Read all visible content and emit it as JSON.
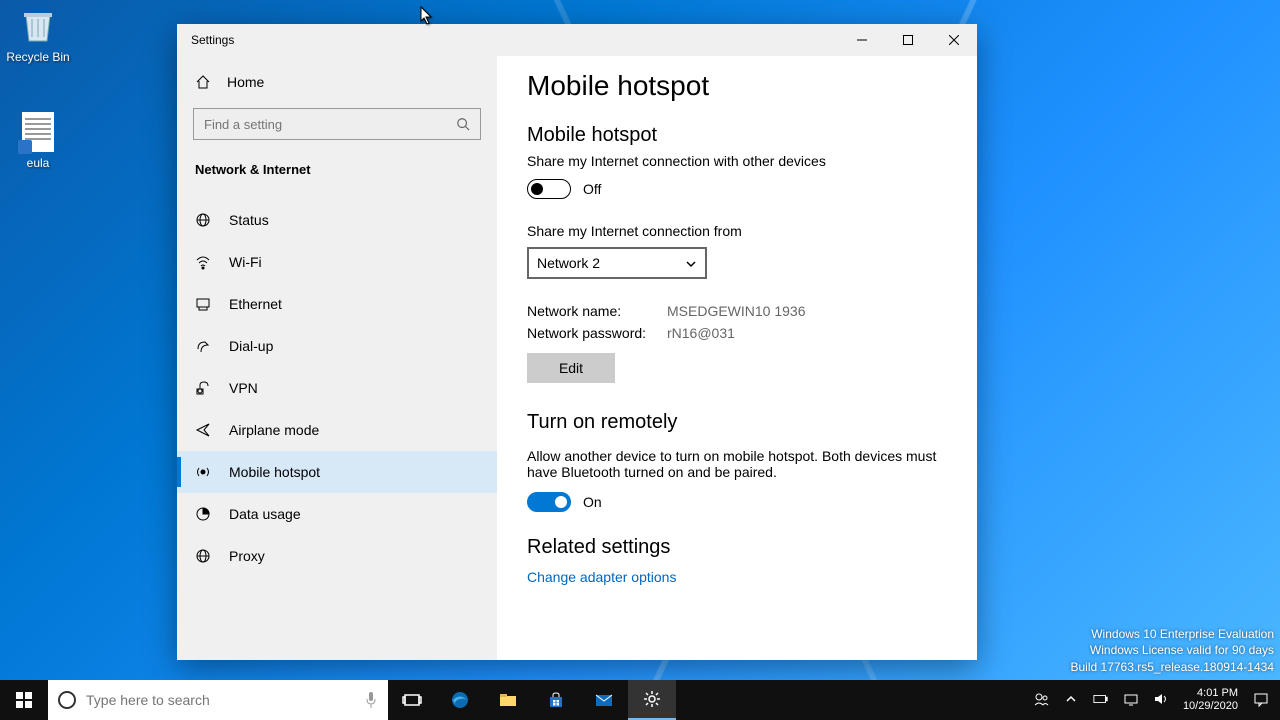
{
  "desktop": {
    "icons": {
      "recycle": "Recycle Bin",
      "eula": "eula"
    }
  },
  "window": {
    "title": "Settings",
    "home": "Home",
    "search_placeholder": "Find a setting",
    "category": "Network & Internet",
    "nav": [
      {
        "key": "status",
        "label": "Status"
      },
      {
        "key": "wifi",
        "label": "Wi-Fi"
      },
      {
        "key": "ethernet",
        "label": "Ethernet"
      },
      {
        "key": "dialup",
        "label": "Dial-up"
      },
      {
        "key": "vpn",
        "label": "VPN"
      },
      {
        "key": "airplane",
        "label": "Airplane mode"
      },
      {
        "key": "hotspot",
        "label": "Mobile hotspot"
      },
      {
        "key": "datausage",
        "label": "Data usage"
      },
      {
        "key": "proxy",
        "label": "Proxy"
      }
    ],
    "selected": "hotspot"
  },
  "page": {
    "title": "Mobile hotspot",
    "hotspot": {
      "heading": "Mobile hotspot",
      "sub": "Share my Internet connection with other devices",
      "state": "Off"
    },
    "share_from": {
      "label": "Share my Internet connection from",
      "value": "Network 2"
    },
    "net_name": {
      "label": "Network name:",
      "value": "MSEDGEWIN10 1936"
    },
    "net_pass": {
      "label": "Network password:",
      "value": "rN16@031"
    },
    "edit": "Edit",
    "remote": {
      "heading": "Turn on remotely",
      "desc": "Allow another device to turn on mobile hotspot. Both devices must have Bluetooth turned on and be paired.",
      "state": "On"
    },
    "related": {
      "heading": "Related settings",
      "link": "Change adapter options"
    }
  },
  "taskbar": {
    "search_placeholder": "Type here to search",
    "time": "4:01 PM",
    "date": "10/29/2020"
  },
  "watermark": {
    "l1": "Windows 10 Enterprise Evaluation",
    "l2": "Windows License valid for 90 days",
    "l3": "Build 17763.rs5_release.180914-1434"
  }
}
